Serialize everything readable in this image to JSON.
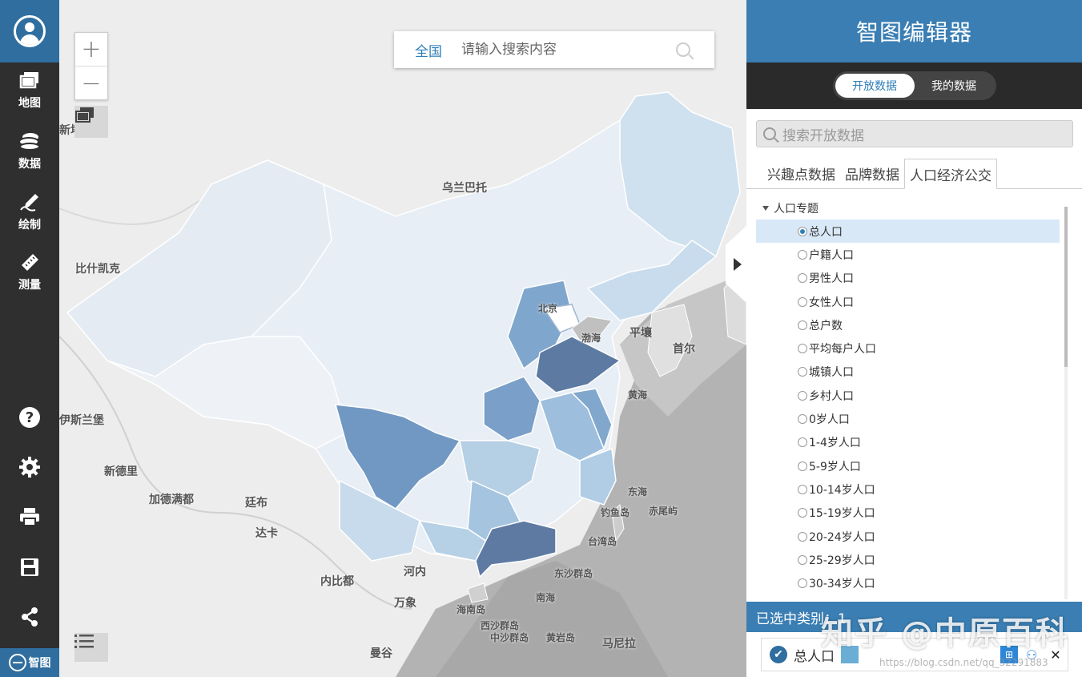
{
  "sidebar": {
    "nav": [
      {
        "label": "地图",
        "icon": "map-layers-icon"
      },
      {
        "label": "数据",
        "icon": "database-icon"
      },
      {
        "label": "绘制",
        "icon": "pen-draw-icon"
      },
      {
        "label": "测量",
        "icon": "ruler-icon"
      }
    ],
    "tools": [
      "help-icon",
      "gear-icon",
      "print-icon",
      "save-icon",
      "share-icon"
    ],
    "brand": "智图"
  },
  "map": {
    "search_scope": "全国",
    "search_placeholder": "请输入搜索内容",
    "labels": {
      "wulanbatuo": "乌兰巴托",
      "bishikaike": "比什凯克",
      "yisilanbao": "伊斯兰堡",
      "xindeli": "新德里",
      "jiademandu": "加德满都",
      "tingbu": "廷布",
      "daka": "达卡",
      "neibidu": "内比都",
      "henei": "河内",
      "wanxiang": "万象",
      "mangu": "曼谷",
      "pingrang": "平壤",
      "shouer": "首尔",
      "bohai": "渤海",
      "huanghai": "黄海",
      "donghai": "东海",
      "diaoyudao": "钓鱼岛",
      "chiweiyu": "赤尾屿",
      "taiwandao": "台湾岛",
      "nanhai": "南海",
      "dongshaqundao": "东沙群岛",
      "xishaqundao": "西沙群岛",
      "zhongshaqundao": "中沙群岛",
      "huangyandao": "黄岩岛",
      "hainandao": "海南岛",
      "malala": "马尼拉",
      "xinta": "新塔",
      "beijing": "北京"
    }
  },
  "panel": {
    "title": "智图编辑器",
    "switch": {
      "open": "开放数据",
      "mine": "我的数据"
    },
    "search_placeholder": "搜索开放数据",
    "tabs": [
      "兴趣点数据",
      "品牌数据",
      "人口经济公交"
    ],
    "tree_root": "人口专题",
    "items": [
      "总人口",
      "户籍人口",
      "男性人口",
      "女性人口",
      "总户数",
      "平均每户人口",
      "城镇人口",
      "乡村人口",
      "0岁人口",
      "1-4岁人口",
      "5-9岁人口",
      "10-14岁人口",
      "15-19岁人口",
      "20-24岁人口",
      "25-29岁人口",
      "30-34岁人口"
    ],
    "selected_count_label": "已选中类别：1",
    "selected_item": "总人口",
    "swatch_color": "#6aaed6"
  },
  "watermark": "知乎 @中原百科",
  "watermark_url": "https://blog.csdn.net/qq_32291883"
}
